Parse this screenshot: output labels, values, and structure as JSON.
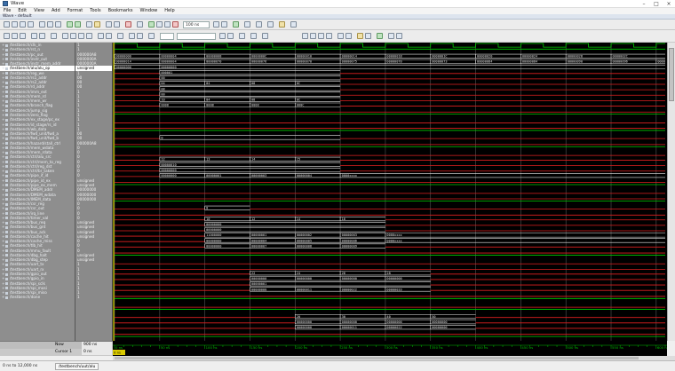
{
  "window": {
    "title": "Wave",
    "subtitle": "Wave - default"
  },
  "menu": [
    "File",
    "Edit",
    "View",
    "Add",
    "Format",
    "Tools",
    "Bookmarks",
    "Window",
    "Help"
  ],
  "toolbar": {
    "time_value": "100 ns",
    "search_select": "",
    "zoom_value": "100"
  },
  "colors": {
    "wave_high": "#00d000",
    "wave_low": "#e02020",
    "wave_bus": "#e8e8e8",
    "cursor": "#ffff00",
    "grid": "#555555"
  },
  "signals": [
    {
      "name": "/testbench/clk_in",
      "value": "1"
    },
    {
      "name": "/testbench/rst_n",
      "value": "1"
    },
    {
      "name": "/testbench/pc_out",
      "value": "000000A8"
    },
    {
      "name": "/testbench/instr_out",
      "value": "0000000A"
    },
    {
      "name": "/testbench/instr_mem_addr",
      "value": "0000000A"
    },
    {
      "name": "/testbench/alu/alu_op",
      "value": "unsigned"
    },
    {
      "name": "/testbench/reg_we",
      "value": "1"
    },
    {
      "name": "/testbench/rs1_addr",
      "value": "00"
    },
    {
      "name": "/testbench/rs2_addr",
      "value": "00"
    },
    {
      "name": "/testbench/rd_addr",
      "value": "00"
    },
    {
      "name": "/testbench/imm_ext",
      "value": "1"
    },
    {
      "name": "/testbench/mem_rd",
      "value": "1"
    },
    {
      "name": "/testbench/mem_wr",
      "value": "1"
    },
    {
      "name": "/testbench/branch_flag",
      "value": "1"
    },
    {
      "name": "/testbench/jump_sig",
      "value": "1"
    },
    {
      "name": "/testbench/zero_flag",
      "value": "1"
    },
    {
      "name": "/testbench/ex_stage/pc_ex",
      "value": "1"
    },
    {
      "name": "/testbench/id_stage/rs_id",
      "value": "1"
    },
    {
      "name": "/testbench/wb_data",
      "value": "1"
    },
    {
      "name": "/testbench/fwd_unit/fwd_a",
      "value": "00"
    },
    {
      "name": "/testbench/fwd_unit/fwd_b",
      "value": "00"
    },
    {
      "name": "/testbench/hazard/stall_ctrl",
      "value": "000000A8"
    },
    {
      "name": "/testbench/mem_wdata",
      "value": "0"
    },
    {
      "name": "/testbench/mem_rdata",
      "value": "0"
    },
    {
      "name": "/testbench/ctrl/alu_src",
      "value": "0"
    },
    {
      "name": "/testbench/ctrl/mem_to_reg",
      "value": "0"
    },
    {
      "name": "/testbench/ctrl/reg_dst",
      "value": "0"
    },
    {
      "name": "/testbench/ctrl/br_taken",
      "value": "0"
    },
    {
      "name": "/testbench/pipe_if_id",
      "value": "0"
    },
    {
      "name": "/testbench/pipe_id_ex",
      "value": "unsigned"
    },
    {
      "name": "/testbench/pipe_ex_mem",
      "value": "unsigned"
    },
    {
      "name": "/testbench/DMEM_addr",
      "value": "00000000"
    },
    {
      "name": "/testbench/DMEM_wdata",
      "value": "00000000"
    },
    {
      "name": "/testbench/IMEM_data",
      "value": "00000000"
    },
    {
      "name": "/testbench/csr_reg",
      "value": "0"
    },
    {
      "name": "/testbench/csr_out",
      "value": "0"
    },
    {
      "name": "/testbench/irq_line",
      "value": "0"
    },
    {
      "name": "/testbench/timer_val",
      "value": "0"
    },
    {
      "name": "/testbench/bus_req",
      "value": "unsigned"
    },
    {
      "name": "/testbench/bus_gnt",
      "value": "unsigned"
    },
    {
      "name": "/testbench/bus_ack",
      "value": "unsigned"
    },
    {
      "name": "/testbench/cache_hit",
      "value": "unsigned"
    },
    {
      "name": "/testbench/cache_miss",
      "value": "0"
    },
    {
      "name": "/testbench/tlb_hit",
      "value": "0"
    },
    {
      "name": "/testbench/mmu_fault",
      "value": "0"
    },
    {
      "name": "/testbench/dbg_halt",
      "value": "unsigned"
    },
    {
      "name": "/testbench/dbg_step",
      "value": "unsigned"
    },
    {
      "name": "/testbench/uart_tx",
      "value": "1"
    },
    {
      "name": "/testbench/uart_rx",
      "value": "1"
    },
    {
      "name": "/testbench/gpio_out",
      "value": "1"
    },
    {
      "name": "/testbench/gpio_in",
      "value": "1"
    },
    {
      "name": "/testbench/spi_sclk",
      "value": "1"
    },
    {
      "name": "/testbench/spi_mosi",
      "value": "1"
    },
    {
      "name": "/testbench/spi_miso",
      "value": "1"
    },
    {
      "name": "/testbench/done",
      "value": "1"
    }
  ],
  "selected_index": 5,
  "clk_row": {
    "row": 0
  },
  "bus_rows": [
    {
      "row": 2,
      "segs": [
        {
          "t": 0,
          "v": "00000000"
        },
        {
          "t": 50,
          "v": "00000004"
        },
        {
          "t": 100,
          "v": "00000008"
        },
        {
          "t": 150,
          "v": "0000000C"
        },
        {
          "t": 200,
          "v": "00000010"
        },
        {
          "t": 250,
          "v": "00000014"
        },
        {
          "t": 300,
          "v": "00000018"
        },
        {
          "t": 350,
          "v": "0000001C"
        },
        {
          "t": 400,
          "v": "00000020"
        },
        {
          "t": 450,
          "v": "00000024"
        },
        {
          "t": 500,
          "v": "00000028"
        },
        {
          "t": 550,
          "v": "0000002C"
        }
      ]
    },
    {
      "row": 3,
      "segs": [
        {
          "t": 0,
          "v": "00000014"
        },
        {
          "t": 50,
          "v": "00000004"
        },
        {
          "t": 100,
          "v": "00000070"
        },
        {
          "t": 150,
          "v": "00000076"
        },
        {
          "t": 200,
          "v": "00000070"
        },
        {
          "t": 250,
          "v": "00000075"
        },
        {
          "t": 300,
          "v": "00000070"
        },
        {
          "t": 350,
          "v": "00000073"
        },
        {
          "t": 400,
          "v": "00000084"
        },
        {
          "t": 450,
          "v": "00000084"
        },
        {
          "t": 500,
          "v": "00000090"
        },
        {
          "t": 550,
          "v": "00000096"
        },
        {
          "t": 600,
          "v": "0000"
        }
      ]
    },
    {
      "row": 4,
      "segs": [
        {
          "t": 0,
          "v": "00000000"
        },
        {
          "t": 50,
          "v": "00000000"
        }
      ]
    },
    {
      "row": 5,
      "segs": [
        {
          "t": 50,
          "v": "000001"
        },
        {
          "t": 250,
          "v": ""
        }
      ]
    },
    {
      "row": 6,
      "segs": [
        {
          "t": 50,
          "v": "00"
        },
        {
          "t": 250,
          "v": ""
        }
      ]
    },
    {
      "row": 7,
      "segs": [
        {
          "t": 50,
          "v": "04"
        },
        {
          "t": 100,
          "v": "04"
        },
        {
          "t": 150,
          "v": "08"
        },
        {
          "t": 200,
          "v": "0C"
        },
        {
          "t": 250,
          "v": ""
        }
      ]
    },
    {
      "row": 8,
      "segs": [
        {
          "t": 50,
          "v": "08"
        },
        {
          "t": 250,
          "v": ""
        }
      ]
    },
    {
      "row": 9,
      "segs": [
        {
          "t": 50,
          "v": "00"
        },
        {
          "t": 250,
          "v": ""
        }
      ]
    },
    {
      "row": 10,
      "segs": [
        {
          "t": 50,
          "v": "10"
        },
        {
          "t": 100,
          "v": "04"
        },
        {
          "t": 150,
          "v": "08"
        },
        {
          "t": 200,
          "v": "0C"
        },
        {
          "t": 250,
          "v": ""
        }
      ]
    },
    {
      "row": 11,
      "segs": [
        {
          "t": 50,
          "v": "0008"
        },
        {
          "t": 100,
          "v": "0008"
        },
        {
          "t": 150,
          "v": "0008"
        },
        {
          "t": 200,
          "v": "000C"
        },
        {
          "t": 250,
          "v": ""
        }
      ]
    },
    {
      "row": 17,
      "segs": [
        {
          "t": 50,
          "v": "0"
        },
        {
          "t": 250,
          "v": ""
        }
      ]
    },
    {
      "row": 21,
      "segs": [
        {
          "t": 50,
          "v": "12"
        },
        {
          "t": 100,
          "v": "13"
        },
        {
          "t": 150,
          "v": "14"
        },
        {
          "t": 200,
          "v": "15"
        },
        {
          "t": 250,
          "v": ""
        }
      ]
    },
    {
      "row": 22,
      "segs": [
        {
          "t": 50,
          "v": "00000010"
        },
        {
          "t": 250,
          "v": ""
        }
      ]
    },
    {
      "row": 23,
      "segs": [
        {
          "t": 50,
          "v": "00000000"
        },
        {
          "t": 250,
          "v": ""
        }
      ]
    },
    {
      "row": 24,
      "segs": [
        {
          "t": 50,
          "v": "00000000"
        },
        {
          "t": 100,
          "v": "00000001"
        },
        {
          "t": 150,
          "v": "00000003"
        },
        {
          "t": 200,
          "v": "00000004"
        },
        {
          "t": 250,
          "v": "0000xxxx"
        }
      ]
    },
    {
      "row": 30,
      "segs": [
        {
          "t": 100,
          "v": "0"
        },
        {
          "t": 150,
          "v": ""
        }
      ]
    },
    {
      "row": 32,
      "segs": [
        {
          "t": 100,
          "v": "10"
        },
        {
          "t": 150,
          "v": "12"
        },
        {
          "t": 200,
          "v": "14"
        },
        {
          "t": 250,
          "v": "16"
        },
        {
          "t": 300,
          "v": ""
        }
      ]
    },
    {
      "row": 33,
      "segs": [
        {
          "t": 100,
          "v": "00000000"
        },
        {
          "t": 300,
          "v": ""
        }
      ]
    },
    {
      "row": 34,
      "segs": [
        {
          "t": 100,
          "v": "00000000"
        },
        {
          "t": 300,
          "v": ""
        }
      ]
    },
    {
      "row": 35,
      "segs": [
        {
          "t": 100,
          "v": "11000000"
        },
        {
          "t": 150,
          "v": "00000001"
        },
        {
          "t": 200,
          "v": "00000002"
        },
        {
          "t": 250,
          "v": "00000003"
        },
        {
          "t": 300,
          "v": "0000xxxx"
        }
      ]
    },
    {
      "row": 36,
      "segs": [
        {
          "t": 100,
          "v": "00000000"
        },
        {
          "t": 150,
          "v": "00000004"
        },
        {
          "t": 200,
          "v": "00000005"
        },
        {
          "t": 250,
          "v": "00000006"
        },
        {
          "t": 300,
          "v": "0000xxxx"
        }
      ]
    },
    {
      "row": 37,
      "segs": [
        {
          "t": 100,
          "v": "00000000"
        },
        {
          "t": 150,
          "v": "00000007"
        },
        {
          "t": 200,
          "v": "00000008"
        },
        {
          "t": 250,
          "v": "00000009"
        },
        {
          "t": 300,
          "v": ""
        }
      ]
    },
    {
      "row": 42,
      "segs": [
        {
          "t": 150,
          "v": "22"
        },
        {
          "t": 200,
          "v": "24"
        },
        {
          "t": 250,
          "v": "26"
        },
        {
          "t": 300,
          "v": "28"
        },
        {
          "t": 350,
          "v": ""
        }
      ]
    },
    {
      "row": 43,
      "segs": [
        {
          "t": 150,
          "v": "00000000"
        },
        {
          "t": 200,
          "v": "00000000"
        },
        {
          "t": 250,
          "v": "00000000"
        },
        {
          "t": 300,
          "v": "00000000"
        },
        {
          "t": 350,
          "v": ""
        }
      ]
    },
    {
      "row": 44,
      "segs": [
        {
          "t": 150,
          "v": "00000001"
        },
        {
          "t": 350,
          "v": ""
        }
      ]
    },
    {
      "row": 45,
      "segs": [
        {
          "t": 150,
          "v": "00000000"
        },
        {
          "t": 200,
          "v": "00000011"
        },
        {
          "t": 250,
          "v": "00000022"
        },
        {
          "t": 300,
          "v": "00000033"
        },
        {
          "t": 350,
          "v": ""
        }
      ]
    },
    {
      "row": 50,
      "segs": [
        {
          "t": 200,
          "v": "20"
        },
        {
          "t": 250,
          "v": "30"
        },
        {
          "t": 300,
          "v": "40"
        },
        {
          "t": 350,
          "v": "50"
        },
        {
          "t": 400,
          "v": ""
        }
      ]
    },
    {
      "row": 51,
      "segs": [
        {
          "t": 200,
          "v": "00000000"
        },
        {
          "t": 250,
          "v": "00000000"
        },
        {
          "t": 300,
          "v": "00000000"
        },
        {
          "t": 350,
          "v": "00000000"
        },
        {
          "t": 400,
          "v": ""
        }
      ]
    },
    {
      "row": 52,
      "segs": [
        {
          "t": 200,
          "v": "00000000"
        },
        {
          "t": 250,
          "v": "00000011"
        },
        {
          "t": 300,
          "v": "00000022"
        },
        {
          "t": 350,
          "v": "00000000"
        },
        {
          "t": 400,
          "v": ""
        }
      ]
    }
  ],
  "bit_rows": [
    {
      "row": 1,
      "pattern": "hi"
    },
    {
      "row": 12,
      "pattern": "lo"
    },
    {
      "row": 13,
      "pattern": "hi"
    },
    {
      "row": 14,
      "pattern": "lo"
    },
    {
      "row": 15,
      "pattern": "lo"
    },
    {
      "row": 16,
      "pattern": "hi"
    },
    {
      "row": 18,
      "pattern": "lo"
    },
    {
      "row": 19,
      "pattern": "hi"
    },
    {
      "row": 20,
      "pattern": "lo"
    },
    {
      "row": 25,
      "pattern": "lo"
    },
    {
      "row": 26,
      "pattern": "hi"
    },
    {
      "row": 27,
      "pattern": "lo"
    },
    {
      "row": 28,
      "pattern": "lo"
    },
    {
      "row": 29,
      "pattern": "hi"
    },
    {
      "row": 31,
      "pattern": "lo"
    },
    {
      "row": 38,
      "pattern": "lo"
    },
    {
      "row": 39,
      "pattern": "hi"
    },
    {
      "row": 40,
      "pattern": "lo"
    },
    {
      "row": 41,
      "pattern": "lo"
    },
    {
      "row": 46,
      "pattern": "lo"
    },
    {
      "row": 47,
      "pattern": "hi"
    },
    {
      "row": 48,
      "pattern": "lo"
    },
    {
      "row": 49,
      "pattern": "hi"
    },
    {
      "row": 53,
      "pattern": "lo"
    },
    {
      "row": 54,
      "pattern": "hi"
    }
  ],
  "timeline": {
    "ticks": [
      "0 ns",
      "50 ns",
      "100 ns",
      "150 ns",
      "200 ns",
      "250 ns",
      "300 ns",
      "350 ns",
      "400 ns",
      "450 ns",
      "500 ns",
      "550 ns",
      "600 ns"
    ],
    "t_max": 610,
    "cursor_label": "0 ns"
  },
  "cursor_panel": {
    "now_label": "Now",
    "now_value": "900 ns",
    "cursor_label": "Cursor 1",
    "cursor_value": "0 ns"
  },
  "status": {
    "range": "0 ns to 12,000 ns",
    "instance": "/testbench/uut/alu"
  }
}
